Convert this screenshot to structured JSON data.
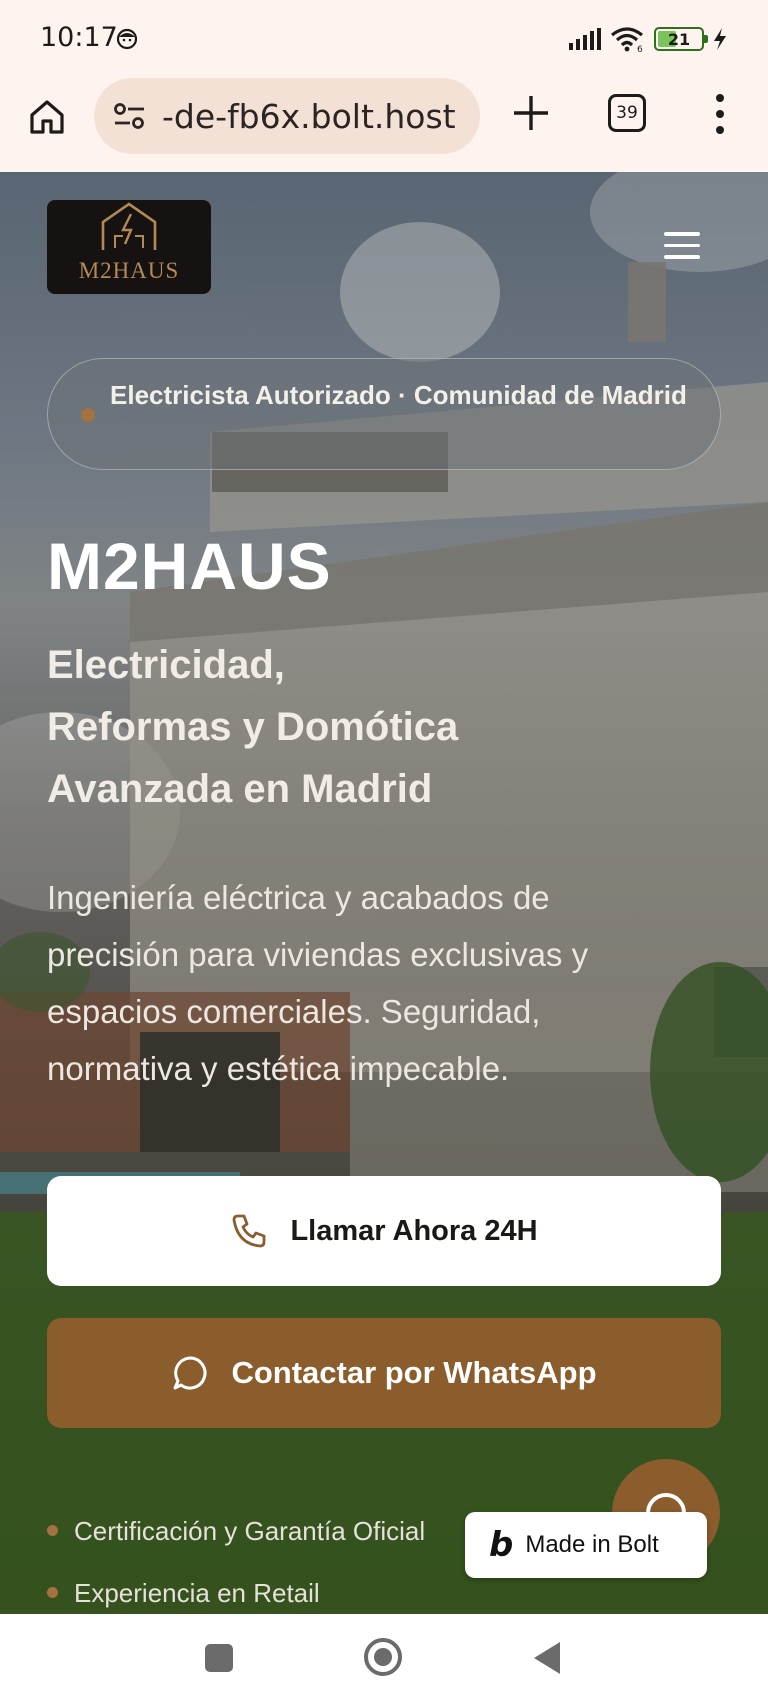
{
  "status_bar": {
    "time": "10:17",
    "battery": "21",
    "icons": [
      "notification-face-icon",
      "signal-icon",
      "wifi-icon",
      "battery-icon",
      "charging-bolt-icon"
    ]
  },
  "browser": {
    "url": "-de-fb6x.bolt.host",
    "tab_count": "39",
    "icons": [
      "home-icon",
      "site-settings-icon",
      "plus-icon",
      "more-vert-icon"
    ]
  },
  "site": {
    "logo_text": "M2HAUS",
    "badge_text": "Electricista Autorizado · Comunidad de Madrid",
    "title": "M2HAUS",
    "subtitle_lines": [
      "Electricidad,",
      "Reformas y Domótica",
      "Avanzada en Madrid"
    ],
    "description": "Ingeniería eléctrica y acabados de precisión para viviendas exclusivas y espacios comerciales. Seguridad, normativa y estética impecable.",
    "call_button": "Llamar Ahora 24H",
    "whatsapp_button": "Contactar por WhatsApp",
    "features": [
      "Certificación y Garantía Oficial",
      "Experiencia en Retail"
    ],
    "made_in_bolt": "Made in Bolt",
    "made_in_bolt_mark": "b"
  },
  "colors": {
    "accent": "#8b5c2c",
    "logo_gold": "#b28a55",
    "status_bg": "#fdf3ef",
    "url_pill": "#f4e1d6"
  }
}
